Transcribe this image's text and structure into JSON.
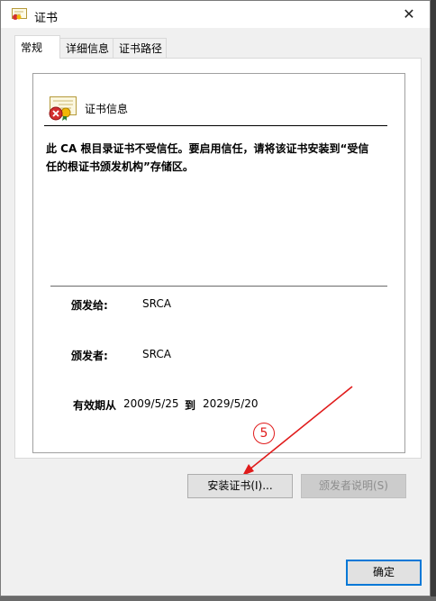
{
  "window": {
    "title": "证书",
    "close_glyph": "✕"
  },
  "tabs": [
    {
      "label": "常规",
      "active": true
    },
    {
      "label": "详细信息",
      "active": false
    },
    {
      "label": "证书路径",
      "active": false
    }
  ],
  "cert_info": {
    "section_title": "证书信息",
    "warning_line1": "此 CA 根目录证书不受信任。要启用信任，请将该证书安装到“受信",
    "warning_line2": "任的根证书颁发机构”存储区。",
    "issued_to_label": "颁发给:",
    "issued_to_value": "SRCA",
    "issued_by_label": "颁发者:",
    "issued_by_value": "SRCA",
    "valid_label": "有效期从",
    "valid_from": "2009/5/25",
    "valid_to_label": "到",
    "valid_to": "2029/5/20"
  },
  "buttons": {
    "install": "安装证书(I)...",
    "issuer_statement": "颁发者说明(S)",
    "ok": "确定"
  },
  "annotation": {
    "step_number": "5"
  },
  "colors": {
    "annotation_red": "#e01b1b",
    "accent_blue": "#0078d7",
    "window_bg": "#f0f0f0"
  },
  "icons": {
    "window": "certificate-icon",
    "section": "certificate-untrusted-icon",
    "close": "close-icon"
  }
}
